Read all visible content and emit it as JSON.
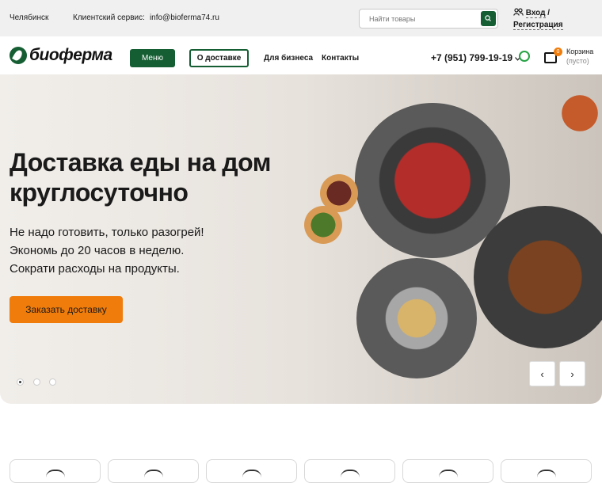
{
  "topbar": {
    "city": "Челябинск",
    "service_label": "Клиентский сервис:",
    "service_email": "info@bioferma74.ru",
    "search_placeholder": "Найти товары",
    "login": "Вход",
    "separator": "/",
    "register": "Регистрация"
  },
  "nav": {
    "logo_text": "биоферма",
    "menu_button": "Меню",
    "delivery_button": "О доставке",
    "business_link": "Для бизнеса",
    "contacts_link": "Контакты",
    "phone": "+7 (951) 799-19-19",
    "cart_count": "0",
    "cart_label": "Корзина",
    "cart_status": "(пусто)"
  },
  "hero": {
    "title": "Доставка еды на дом круглосуточно",
    "line1": "Не надо готовить, только разогрей!",
    "line2": "Экономь до 20 часов в неделю.",
    "line3": "Сократи расходы на продукты.",
    "cta": "Заказать доставку",
    "prev": "‹",
    "next": "›",
    "slide_count": 3,
    "active_slide": 1
  },
  "features": {
    "card_count": 6
  },
  "colors": {
    "brand_green": "#155e33",
    "accent_orange": "#f07c0b",
    "whatsapp": "#25a244"
  }
}
